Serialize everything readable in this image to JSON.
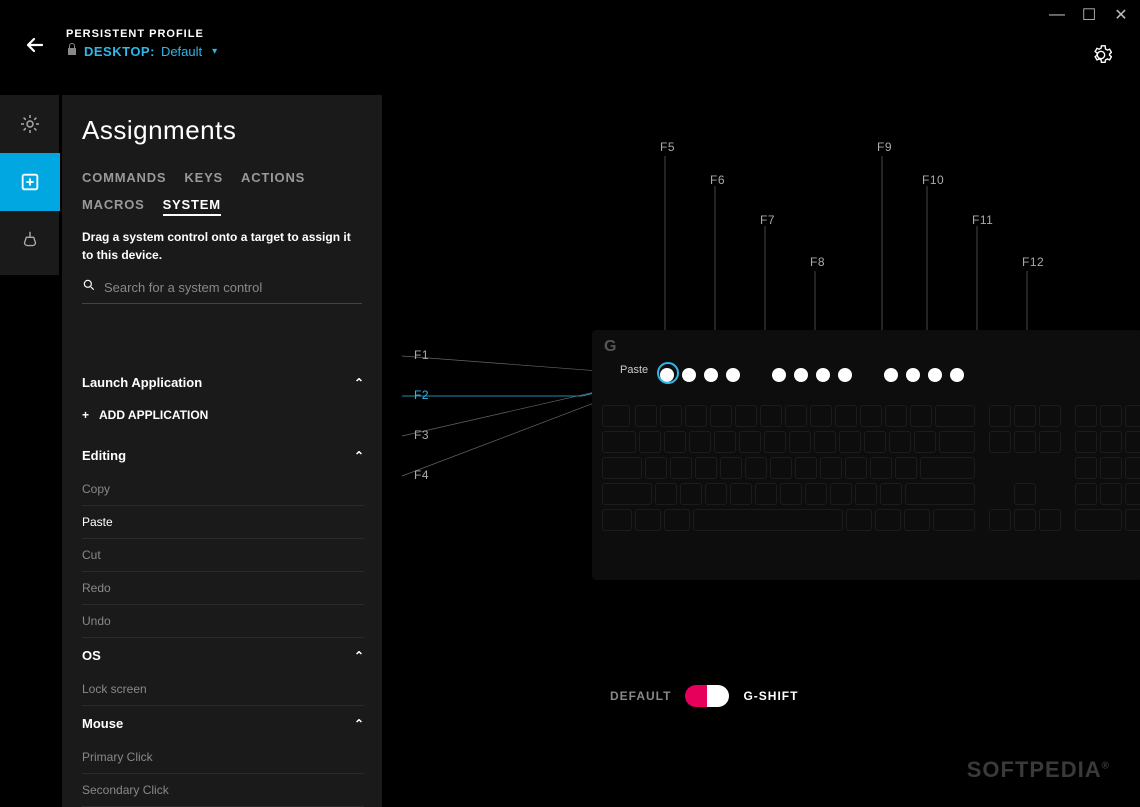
{
  "titlebar": {
    "minimize": "—",
    "maximize": "☐",
    "close": "✕"
  },
  "header": {
    "profile_label": "PERSISTENT PROFILE",
    "profile_type": "DESKTOP:",
    "profile_name": "Default"
  },
  "panel": {
    "title": "Assignments",
    "tabs1": [
      "COMMANDS",
      "KEYS",
      "ACTIONS"
    ],
    "tabs2": [
      "MACROS",
      "SYSTEM"
    ],
    "active_tab": "SYSTEM",
    "instruction": "Drag a system control onto a target to assign it to this device.",
    "search_placeholder": "Search for a system control",
    "sections": {
      "launch": {
        "title": "Launch Application",
        "add": "ADD APPLICATION"
      },
      "editing": {
        "title": "Editing",
        "items": [
          "Copy",
          "Paste",
          "Cut",
          "Redo",
          "Undo"
        ],
        "selected": "Paste"
      },
      "os": {
        "title": "OS",
        "items": [
          "Lock screen"
        ]
      },
      "mouse": {
        "title": "Mouse",
        "items": [
          "Primary Click",
          "Secondary Click"
        ]
      }
    }
  },
  "preview": {
    "fkeys_left": [
      "F1",
      "F2",
      "F3",
      "F4"
    ],
    "fkeys_top": [
      "F5",
      "F6",
      "F7",
      "F8",
      "F9",
      "F10",
      "F11",
      "F12"
    ],
    "active_fkey": "F2",
    "assignment_badge": "Paste"
  },
  "toggle": {
    "left": "DEFAULT",
    "right": "G-SHIFT"
  },
  "branding": "SOFTPEDIA"
}
